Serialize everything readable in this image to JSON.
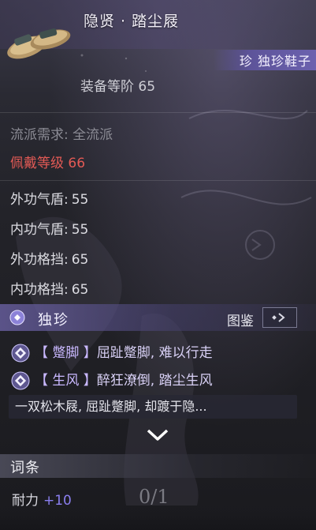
{
  "item": {
    "title": "隐贤 · 踏尘屐",
    "quality_tag": "珍 独珍鞋子",
    "gear_level": "装备等阶 65"
  },
  "requirements": {
    "school": "流派需求: 全流派",
    "level": "佩戴等级 66"
  },
  "stats": [
    {
      "label": "外功气盾:",
      "value": "55"
    },
    {
      "label": "内功气盾:",
      "value": "55"
    },
    {
      "label": "外功格挡:",
      "value": "65"
    },
    {
      "label": "内功格挡:",
      "value": "65"
    }
  ],
  "set": {
    "name": "独珍",
    "codex_label": "图鉴"
  },
  "effects": [
    {
      "tag": "【 蹩脚 】",
      "text": "屈趾蹩脚, 难以行走"
    },
    {
      "tag": "【 生风 】",
      "text": "醉狂潦倒, 踏尘生风"
    }
  ],
  "description": "一双松木屐, 屈趾蹩脚, 却踱于隐...",
  "affix": {
    "title": "词条",
    "line_label": "耐力",
    "line_value": "+10",
    "counter": "0/1"
  },
  "colors": {
    "quality_purple": "#6e64b4",
    "requirement_red": "#e35a55",
    "affix_value": "#8b7ff0"
  }
}
